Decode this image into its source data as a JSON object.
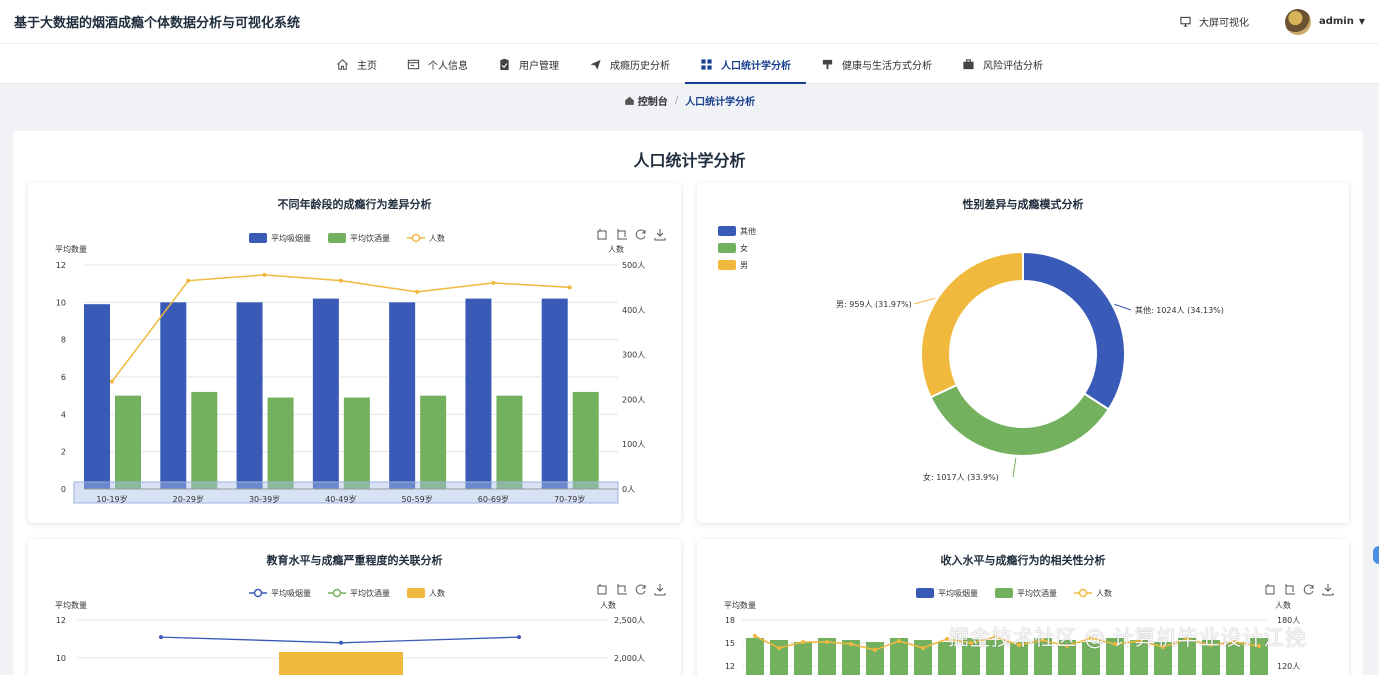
{
  "app": {
    "title": "基于大数据的烟酒成瘾个体数据分析与可视化系统"
  },
  "header": {
    "bigscreen_label": "大屏可视化",
    "username": "admin"
  },
  "nav": {
    "items": [
      {
        "label": "主页",
        "icon": "home-icon",
        "active": false
      },
      {
        "label": "个人信息",
        "icon": "id-card-icon",
        "active": false
      },
      {
        "label": "用户管理",
        "icon": "clipboard-icon",
        "active": false
      },
      {
        "label": "成瘾历史分析",
        "icon": "send-icon",
        "active": false
      },
      {
        "label": "人口统计学分析",
        "icon": "grid-icon",
        "active": true
      },
      {
        "label": "健康与生活方式分析",
        "icon": "stamp-icon",
        "active": false
      },
      {
        "label": "风险评估分析",
        "icon": "briefcase-icon",
        "active": false
      }
    ]
  },
  "breadcrumb": {
    "home": "控制台",
    "current": "人口统计学分析"
  },
  "page_title": "人口统计学分析",
  "colors": {
    "blue": "#3a5ab8",
    "green": "#74b15f",
    "yellow": "#f0b93d",
    "accent": "#1a3f8f"
  },
  "chart_data": [
    {
      "type": "bar",
      "title": "不同年龄段的成瘾行为差异分析",
      "categories": [
        "10-19岁",
        "20-29岁",
        "30-39岁",
        "40-49岁",
        "50-59岁",
        "60-69岁",
        "70-79岁"
      ],
      "ylabel": "平均数量",
      "y2label": "人数",
      "ylim": [
        0,
        12
      ],
      "y_ticks": [
        "0",
        "2",
        "4",
        "6",
        "8",
        "10",
        "12"
      ],
      "y2lim": [
        0,
        500
      ],
      "y2_ticks": [
        "0人",
        "100人",
        "200人",
        "300人",
        "400人",
        "500人"
      ],
      "legend": [
        "平均吸烟量",
        "平均饮酒量",
        "人数"
      ],
      "series": [
        {
          "name": "平均吸烟量",
          "type": "bar",
          "axis": "left",
          "color": "#3a5ab8",
          "values": [
            9.9,
            10.0,
            10.0,
            10.2,
            10.0,
            10.2,
            10.2
          ]
        },
        {
          "name": "平均饮酒量",
          "type": "bar",
          "axis": "left",
          "color": "#74b15f",
          "values": [
            5.0,
            5.2,
            4.9,
            4.9,
            5.0,
            5.0,
            5.2
          ]
        },
        {
          "name": "人数",
          "type": "line",
          "axis": "right",
          "color": "#f0b93d",
          "values": [
            240,
            465,
            478,
            465,
            440,
            460,
            450
          ]
        }
      ]
    },
    {
      "type": "pie",
      "title": "性别差异与成瘾模式分析",
      "legend": [
        "其他",
        "女",
        "男"
      ],
      "slices": [
        {
          "name": "其他",
          "value": 1024,
          "percent": 34.13,
          "color": "#3a5ab8",
          "label": "其他: 1024人 (34.13%)"
        },
        {
          "name": "女",
          "value": 1017,
          "percent": 33.9,
          "color": "#74b15f",
          "label": "女: 1017人 (33.9%)"
        },
        {
          "name": "男",
          "value": 959,
          "percent": 31.97,
          "color": "#f0b93d",
          "label": "男: 959人 (31.97%)"
        }
      ]
    },
    {
      "type": "bar",
      "title": "教育水平与成瘾严重程度的关联分析",
      "ylabel": "平均数量",
      "y2label": "人数",
      "y_ticks": [
        "10",
        "12"
      ],
      "y2_ticks": [
        "2,000人",
        "2,500人"
      ],
      "legend": [
        "平均吸烟量",
        "平均饮酒量",
        "人数"
      ],
      "series": [
        {
          "name": "平均吸烟量",
          "type": "line",
          "color": "#3a5ab8",
          "values": [
            11.1,
            10.8,
            11.1
          ]
        },
        {
          "name": "人数",
          "type": "bar",
          "color": "#f0b93d"
        }
      ]
    },
    {
      "type": "bar",
      "title": "收入水平与成瘾行为的相关性分析",
      "ylabel": "平均数量",
      "y2label": "人数",
      "y_ticks": [
        "12",
        "15",
        "18"
      ],
      "y2_ticks": [
        "120人",
        "180人"
      ],
      "legend": [
        "平均吸烟量",
        "平均饮酒量",
        "人数"
      ]
    }
  ],
  "watermark": "掘金技术社区 @ 计算机毕业设计江挽"
}
